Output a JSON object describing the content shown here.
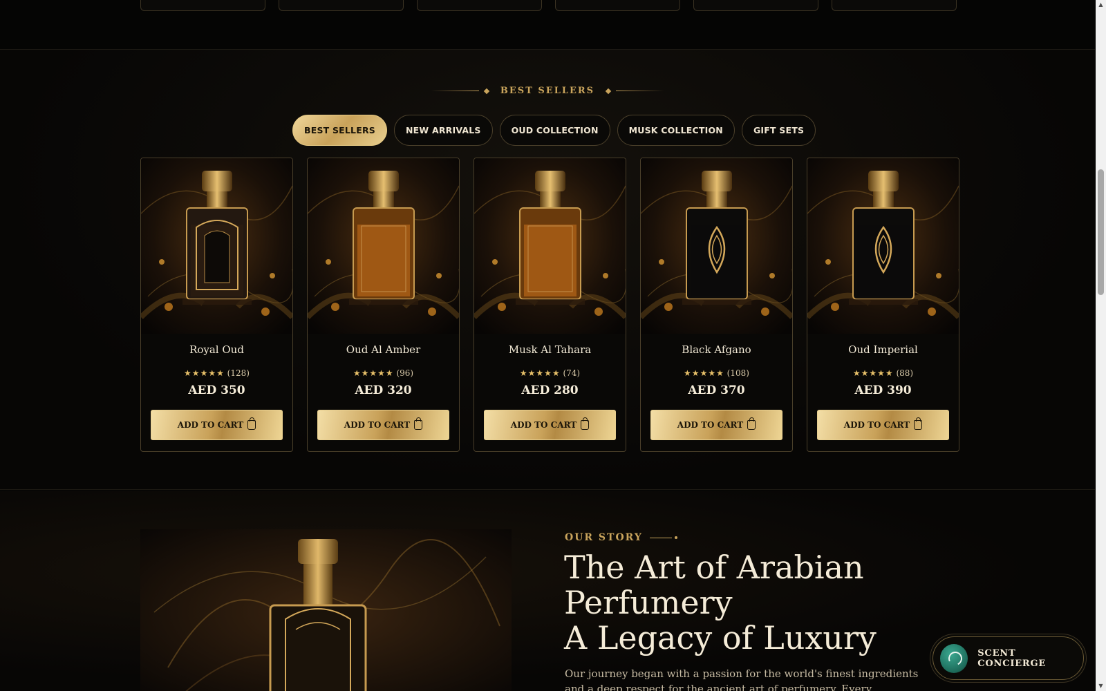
{
  "best_sellers": {
    "heading": "BEST SELLERS",
    "tabs": [
      {
        "label": "BEST SELLERS",
        "active": true
      },
      {
        "label": "NEW ARRIVALS",
        "active": false
      },
      {
        "label": "OUD COLLECTION",
        "active": false
      },
      {
        "label": "MUSK COLLECTION",
        "active": false
      },
      {
        "label": "GIFT SETS",
        "active": false
      }
    ],
    "products": [
      {
        "name": "Royal Oud",
        "stars": "★★★★★",
        "reviews": "(128)",
        "price": "AED 350",
        "cta": "ADD TO CART",
        "bottle": "clear"
      },
      {
        "name": "Oud Al Amber",
        "stars": "★★★★★",
        "reviews": "(96)",
        "price": "AED 320",
        "cta": "ADD TO CART",
        "bottle": "amber"
      },
      {
        "name": "Musk Al Tahara",
        "stars": "★★★★★",
        "reviews": "(74)",
        "price": "AED 280",
        "cta": "ADD TO CART",
        "bottle": "amber"
      },
      {
        "name": "Black Afgano",
        "stars": "★★★★★",
        "reviews": "(108)",
        "price": "AED 370",
        "cta": "ADD TO CART",
        "bottle": "black"
      },
      {
        "name": "Oud Imperial",
        "stars": "★★★★★",
        "reviews": "(88)",
        "price": "AED 390",
        "cta": "ADD TO CART",
        "bottle": "black"
      }
    ]
  },
  "story": {
    "kicker": "OUR STORY",
    "title_line1": "The Art of Arabian",
    "title_line2": "Perfumery",
    "title_line3": "A Legacy of Luxury",
    "body": "Our journey began with a passion for the world's finest ingredients and a deep respect for the ancient art of perfumery. Every fragrance we create is a blend of"
  },
  "concierge": {
    "label": "SCENT CONCIERGE",
    "icon": "chat-bubble-icon"
  },
  "colors": {
    "background": "#050504",
    "gold": "#c9a45c",
    "gold_light": "#f0d79a",
    "text": "#f3ead6"
  }
}
